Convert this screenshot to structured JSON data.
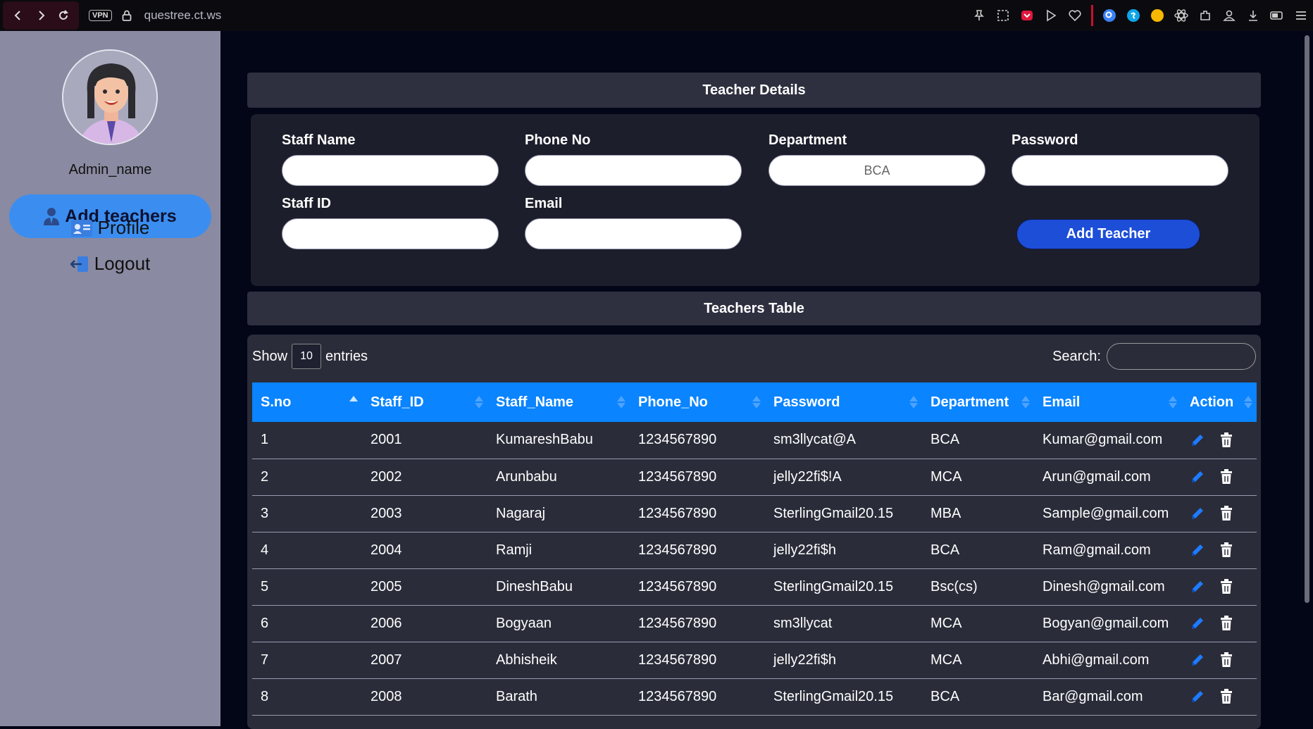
{
  "browser": {
    "vpn_label": "VPN",
    "url_host": "questree",
    "url_rest": ".ct.ws"
  },
  "sidebar": {
    "admin_name": "Admin_name",
    "items": [
      {
        "label": "Add teachers",
        "icon": "user-icon",
        "active": true
      },
      {
        "label": "Profile",
        "icon": "id-card-icon"
      },
      {
        "label": "Logout",
        "icon": "logout-icon"
      }
    ]
  },
  "form": {
    "heading": "Teacher Details",
    "staff_name_label": "Staff Name",
    "phone_label": "Phone No",
    "department_label": "Department",
    "department_value": "BCA",
    "password_label": "Password",
    "staff_id_label": "Staff ID",
    "email_label": "Email",
    "submit_label": "Add Teacher"
  },
  "table": {
    "heading": "Teachers Table",
    "show_label": "Show",
    "entries_value": "10",
    "entries_label": "entries",
    "search_label": "Search:",
    "columns": [
      "S.no",
      "Staff_ID",
      "Staff_Name",
      "Phone_No",
      "Password",
      "Department",
      "Email",
      "Action"
    ],
    "rows": [
      [
        "1",
        "2001",
        "KumareshBabu",
        "1234567890",
        "sm3llycat@A",
        "BCA",
        "Kumar@gmail.com"
      ],
      [
        "2",
        "2002",
        "Arunbabu",
        "1234567890",
        "jelly22fi$!A",
        "MCA",
        "Arun@gmail.com"
      ],
      [
        "3",
        "2003",
        "Nagaraj",
        "1234567890",
        "SterlingGmail20.15",
        "MBA",
        "Sample@gmail.com"
      ],
      [
        "4",
        "2004",
        "Ramji",
        "1234567890",
        "jelly22fi$h",
        "BCA",
        "Ram@gmail.com"
      ],
      [
        "5",
        "2005",
        "DineshBabu",
        "1234567890",
        "SterlingGmail20.15",
        "Bsc(cs)",
        "Dinesh@gmail.com"
      ],
      [
        "6",
        "2006",
        "Bogyaan",
        "1234567890",
        "sm3llycat",
        "MCA",
        "Bogyan@gmail.com"
      ],
      [
        "7",
        "2007",
        "Abhisheik",
        "1234567890",
        "jelly22fi$h",
        "MCA",
        "Abhi@gmail.com"
      ],
      [
        "8",
        "2008",
        "Barath",
        "1234567890",
        "SterlingGmail20.15",
        "BCA",
        "Bar@gmail.com"
      ]
    ]
  },
  "colors": {
    "accent": "#0a84ff",
    "sidebar_bg": "#8a8aa2",
    "active_nav": "#3b8ef0",
    "submit_btn": "#1d4ed8",
    "page_bg": "#020617"
  }
}
